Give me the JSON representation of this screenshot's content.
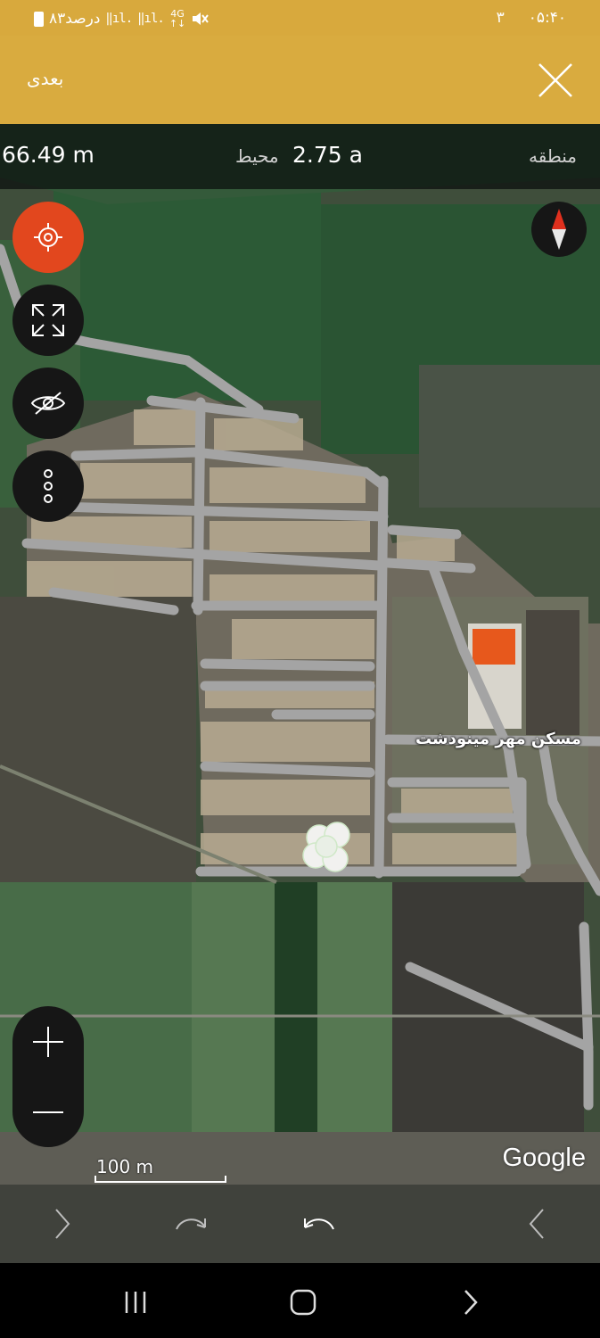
{
  "status_bar": {
    "battery_text": "۸۳درصد",
    "network_type": "4G",
    "time": "۰۵:۴۰",
    "notification_count": "۳"
  },
  "app_bar": {
    "next_label": "بعدی"
  },
  "measurement": {
    "perimeter_value": "66.49 m",
    "perimeter_label": "محیط",
    "area_value": "2.75 a",
    "area_label": "منطقه"
  },
  "map": {
    "place_label": "مسکن مهر مینودشت",
    "scale_label": "100 m",
    "attribution": "Google"
  },
  "colors": {
    "app_bar": "#d9ab3f",
    "status_bar": "#d8a93d",
    "locate_button": "#e2471e",
    "road": "#a4a4a4"
  },
  "icons": {
    "close": "close-icon",
    "locate": "crosshair-icon",
    "fullscreen": "expand-icon",
    "visibility": "eye-off-icon",
    "more": "more-vertical-icon",
    "compass": "compass-icon",
    "zoom_in": "plus-icon",
    "zoom_out": "minus-icon",
    "redo": "redo-icon",
    "undo": "undo-icon"
  }
}
